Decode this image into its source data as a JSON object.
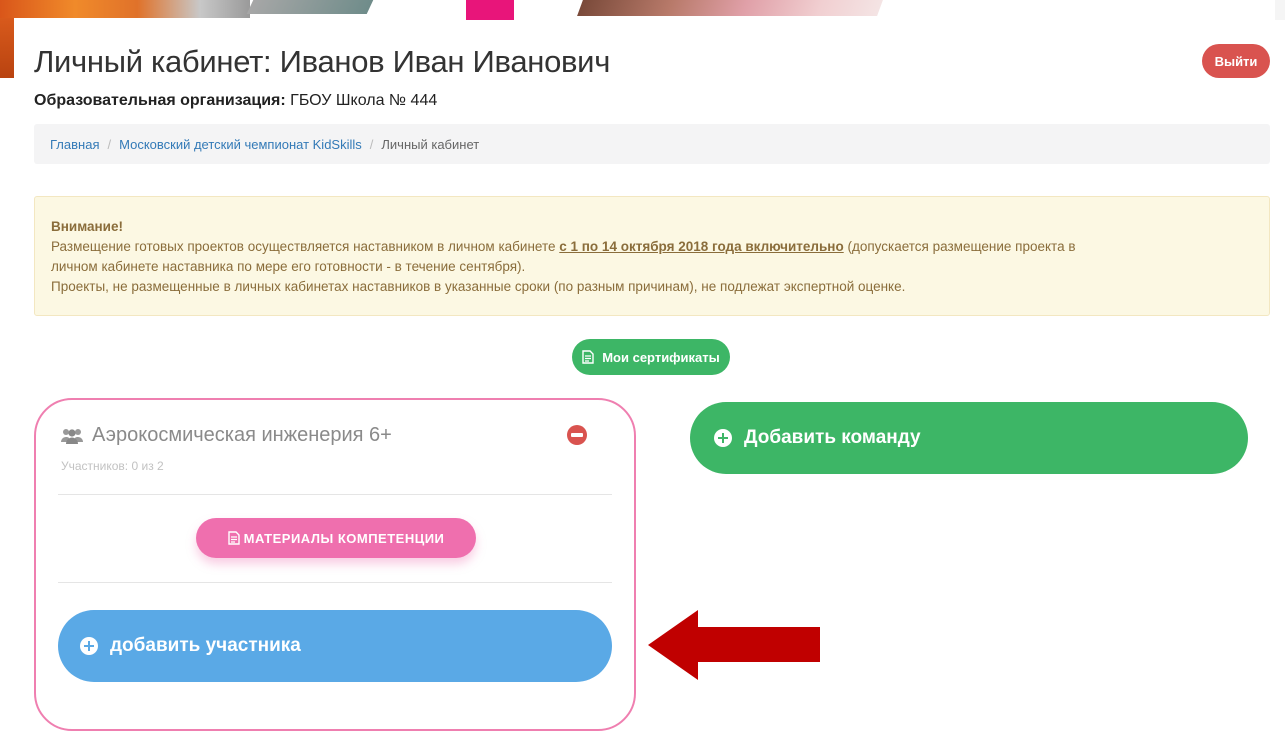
{
  "page": {
    "title": "Личный кабинет: Иванов Иван Иванович",
    "logout_label": "Выйти",
    "org_label": "Образовательная организация:",
    "org_value": "ГБОУ Школа № 444"
  },
  "breadcrumb": {
    "items": [
      "Главная",
      "Московский детский чемпионат KidSkills",
      "Личный кабинет"
    ],
    "separator": "/"
  },
  "alert": {
    "title": "Внимание!",
    "line1_before": "Размещение готовых проектов осуществляется наставником в личном кабинете ",
    "line1_strong": "с 1 по 14 октября 2018 года включительно",
    "line1_after": " (допускается размещение проекта в",
    "line2": "личном кабинете наставника по мере его готовности - в течение сентября).",
    "line3": "Проекты, не размещенные в личных кабинетах наставников в указанные сроки (по разным причинам), не подлежат экспертной оценке."
  },
  "certificates_button": "Мои сертификаты",
  "team": {
    "name": "Аэрокосмическая инженерия 6+",
    "members_count": "Участников: 0 из 2",
    "materials_button": "МАТЕРИАЛЫ КОМПЕТЕНЦИИ",
    "add_member_button": "добавить участника"
  },
  "add_team_button": "Добавить команду",
  "colors": {
    "green": "#3db666",
    "blue": "#5aa9e6",
    "pink": "#ef6fae",
    "red": "#d9534f",
    "arrow": "#c00000",
    "alert_bg": "#fcf8e3",
    "alert_text": "#8a6d3b"
  },
  "icons": {
    "certificates": "document-icon",
    "team": "users-icon",
    "remove": "minus-circle-icon",
    "materials": "document-icon",
    "add": "plus-circle-icon",
    "annotation": "left-arrow-icon"
  }
}
